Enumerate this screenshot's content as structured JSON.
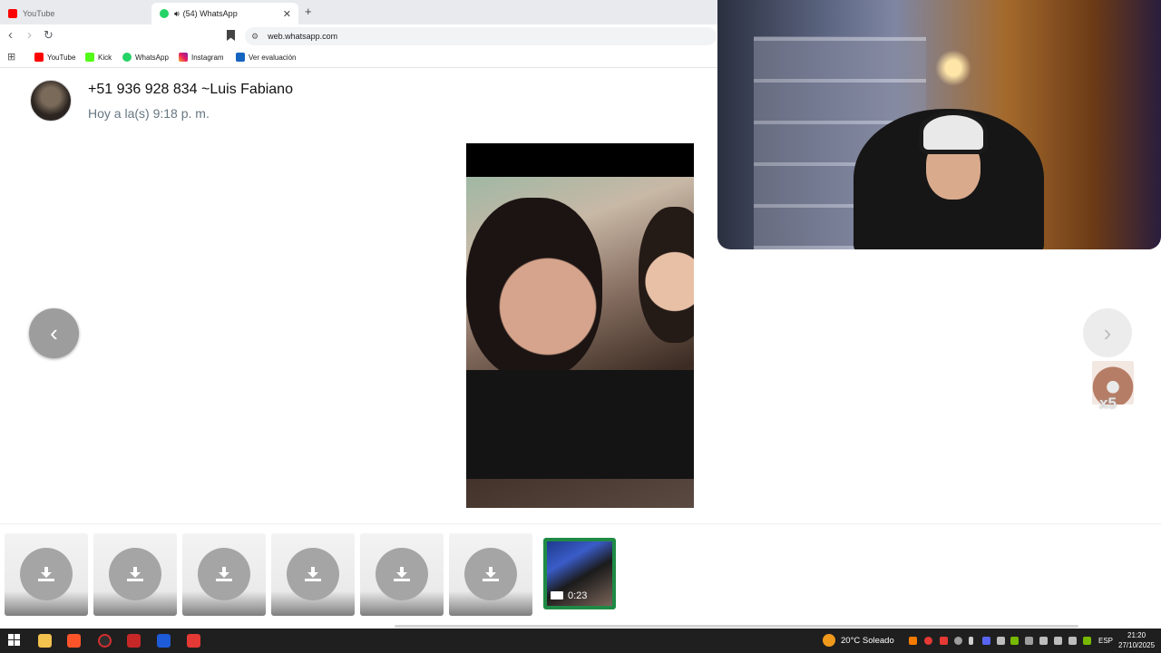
{
  "browser": {
    "tabs": [
      {
        "label": "YouTube",
        "active": false
      },
      {
        "label": "(54) WhatsApp",
        "active": true
      }
    ],
    "new_tab": "+",
    "url": "web.whatsapp.com",
    "bookmarks": [
      "YouTube",
      "Kick",
      "WhatsApp",
      "Instagram",
      "Ver evaluación"
    ]
  },
  "viewer": {
    "contact_name": "+51 936 928 834 ~Luis Fabiano",
    "timestamp": "Hoy a la(s) 9:18 p. m.",
    "prev_glyph": "‹",
    "next_glyph": "›",
    "active_thumb_duration": "0:23",
    "thumbnail_count": 7
  },
  "emote": {
    "count": "x5"
  },
  "taskbar": {
    "weather": "20°C  Soleado",
    "language": "ESP",
    "time": "21:20",
    "date": "27/10/2025"
  },
  "colors": {
    "accent_green": "#1f8a45",
    "whatsapp_green": "#25d366",
    "youtube_red": "#ff0000"
  }
}
